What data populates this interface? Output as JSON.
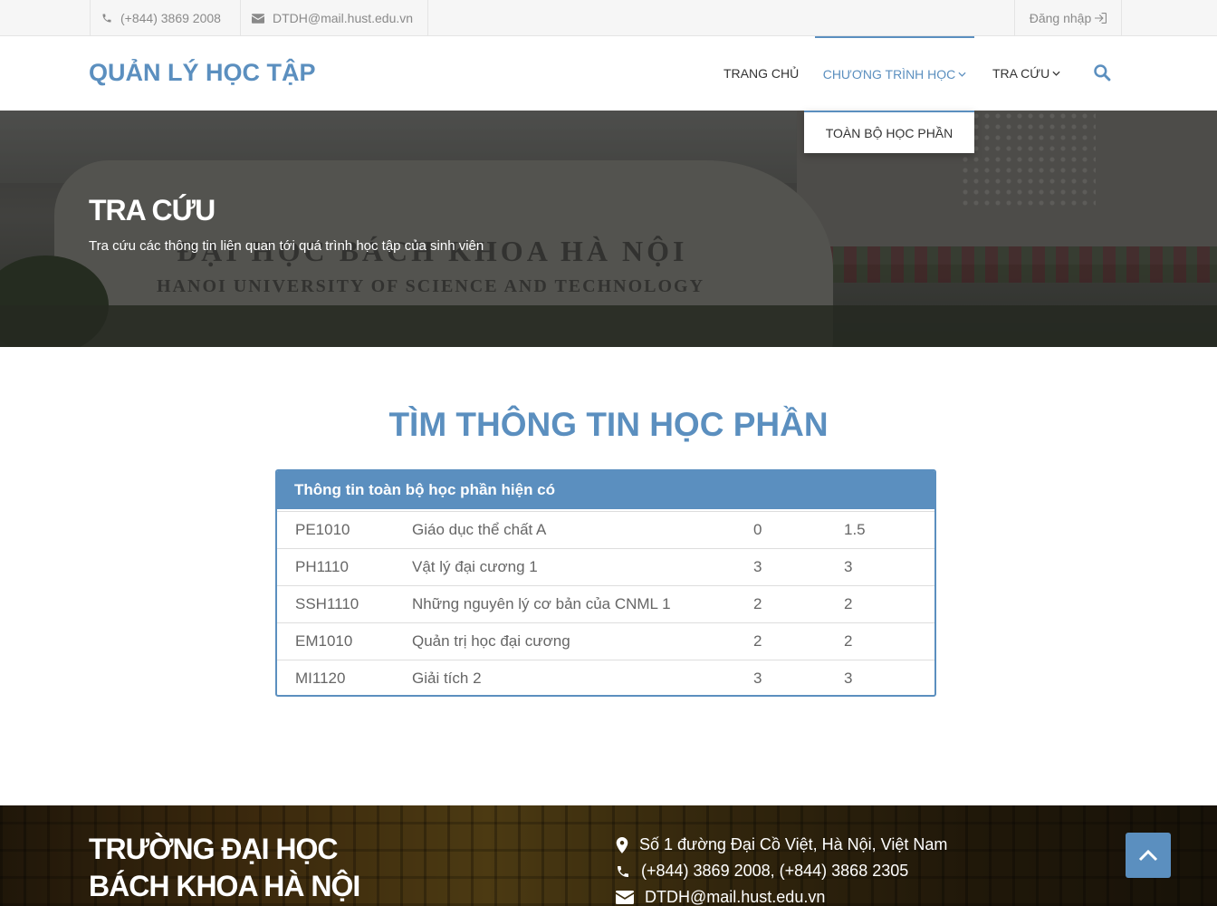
{
  "topbar": {
    "phone": "(+844) 3869 2008",
    "email": "DTDH@mail.hust.edu.vn",
    "login": "Đăng nhập"
  },
  "nav": {
    "brand": "QUẢN LÝ HỌC TẬP",
    "items": [
      {
        "label": "TRANG CHỦ"
      },
      {
        "label": "CHƯƠNG TRÌNH HỌC"
      },
      {
        "label": "TRA CỨU"
      }
    ],
    "dropdown_item": "TOÀN BỘ HỌC PHẦN"
  },
  "hero": {
    "title": "TRA CỨU",
    "subtitle": "Tra cứu các thông tin liên quan tới quá trình học tập của sinh viên",
    "stone_line1": "ĐẠI HỌC BÁCH KHOA HÀ NỘI",
    "stone_line2": "HANOI UNIVERSITY OF SCIENCE AND TECHNOLOGY"
  },
  "section": {
    "title": "TÌM THÔNG TIN HỌC PHẦN",
    "panel_heading": "Thông tin toàn bộ học phần hiện có",
    "rows": [
      [
        "PE1010",
        "Giáo dục thể chất A",
        "0",
        "1.5"
      ],
      [
        "PH1110",
        "Vật lý đại cương 1",
        "3",
        "3"
      ],
      [
        "SSH1110",
        "Những nguyên lý cơ bản của CNML 1",
        "2",
        "2"
      ],
      [
        "EM1010",
        "Quản trị học đại cương",
        "2",
        "2"
      ],
      [
        "MI1120",
        "Giải tích 2",
        "3",
        "3"
      ]
    ]
  },
  "footer": {
    "school_line1": "TRƯỜNG ĐẠI HỌC",
    "school_line2": "BÁCH KHOA HÀ NỘI",
    "address": "Số 1 đường Đại Cồ Việt, Hà Nội, Việt Nam",
    "phones": "(+844) 3869 2008, (+844) 3868 2305",
    "email": "DTDH@mail.hust.edu.vn"
  },
  "colors": {
    "accent": "#5b8fbf",
    "text": "#555555",
    "topbar_bg": "#f6f6f6"
  }
}
